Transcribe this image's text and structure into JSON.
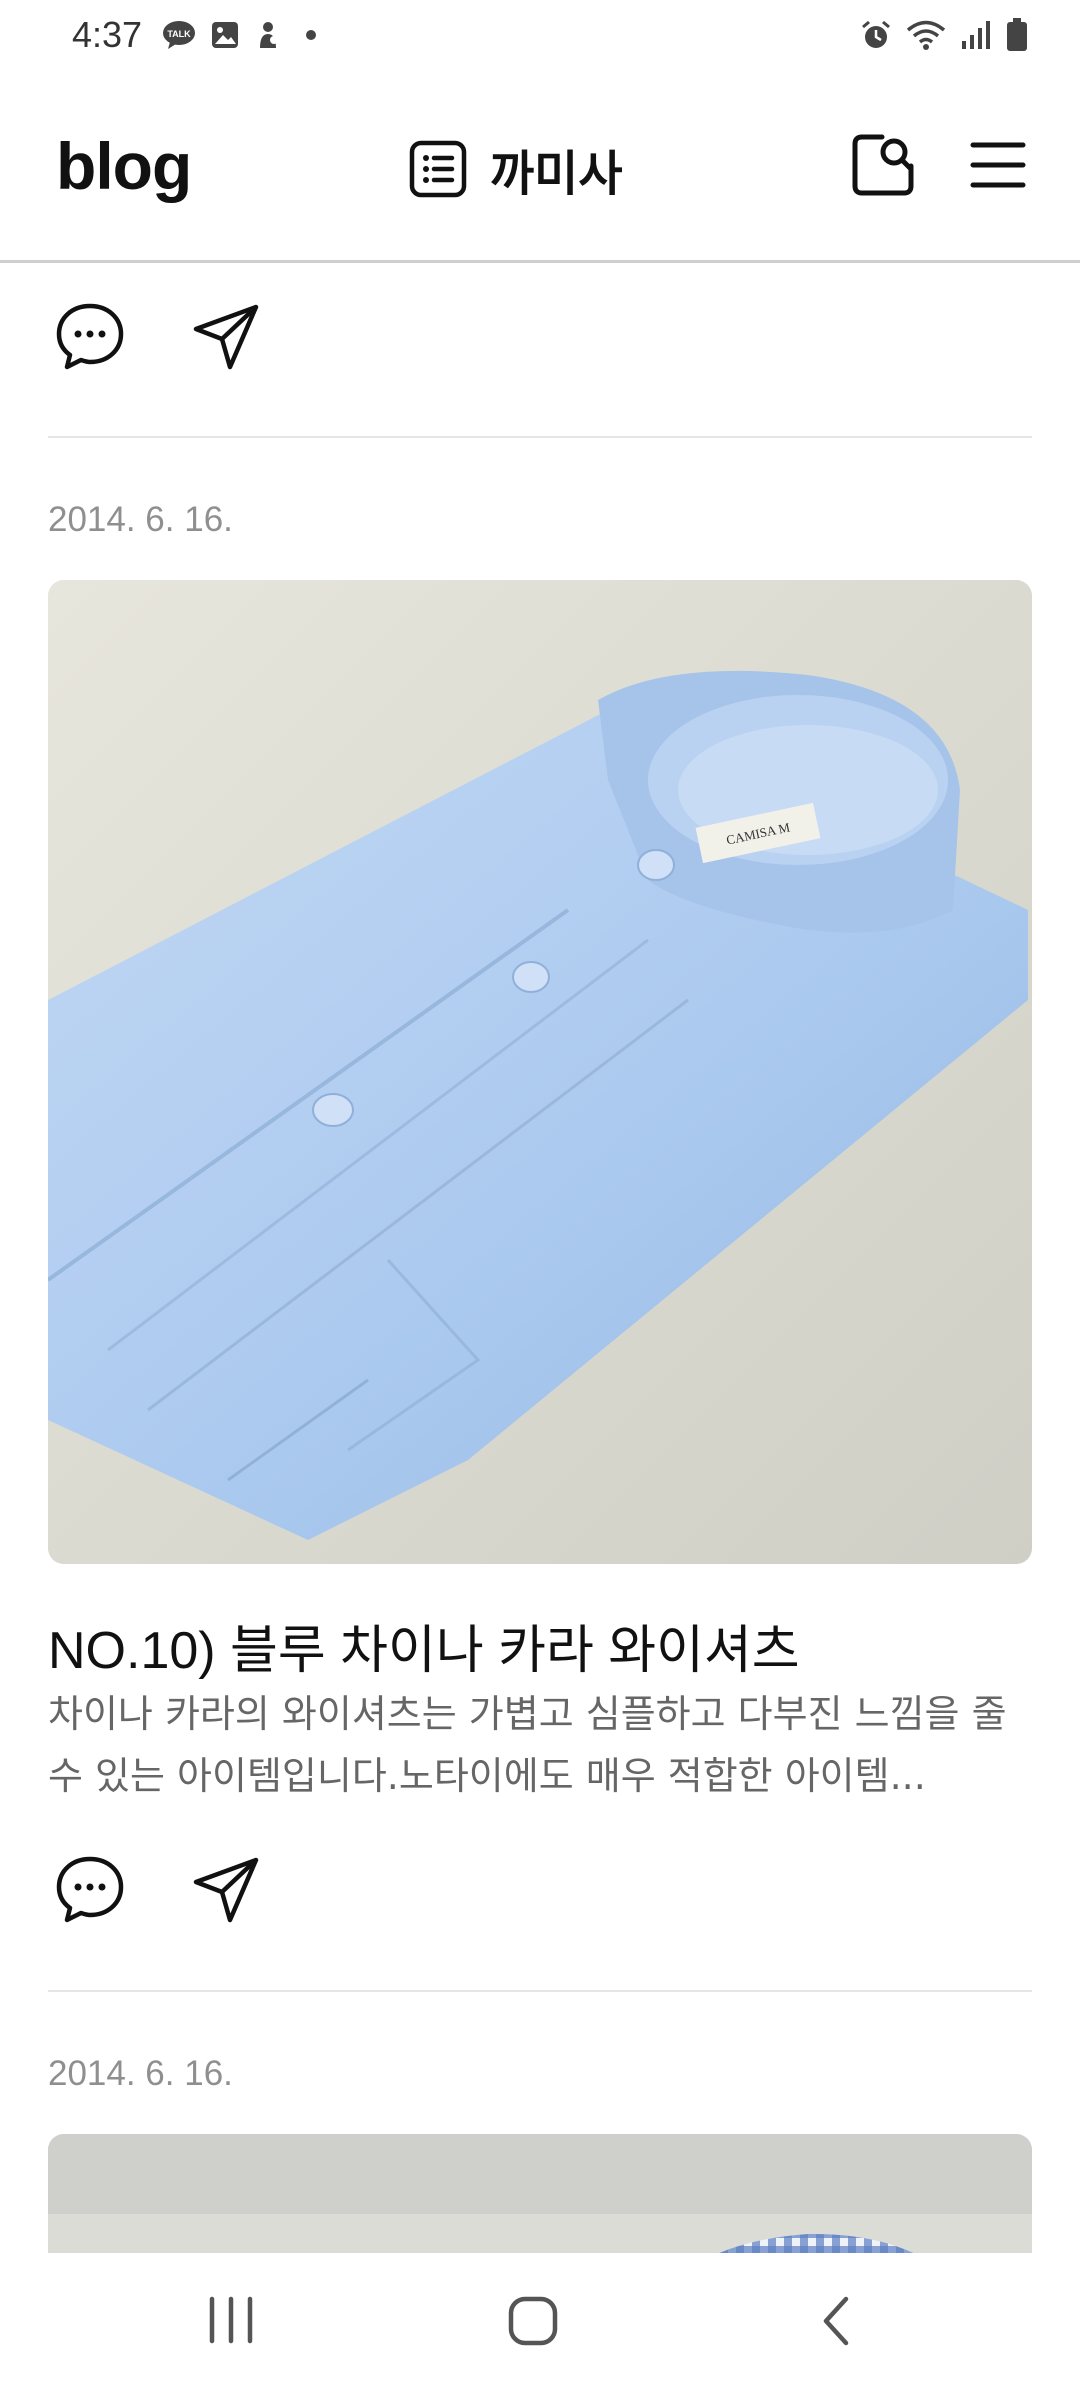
{
  "status_bar": {
    "time": "4:37",
    "left_icons": [
      "kakaotalk-icon",
      "gallery-icon",
      "app-icon",
      "dot-icon"
    ],
    "right_icons": [
      "alarm-icon",
      "wifi-icon",
      "signal-icon",
      "battery-icon"
    ]
  },
  "header": {
    "logo": "blog",
    "blog_title": "까미사",
    "icons": [
      "list-icon",
      "search-icon",
      "menu-icon"
    ]
  },
  "posts": [
    {
      "date": "2014. 6. 16.",
      "title": "NO.10) 블루 차이나 카라 와이셔츠",
      "excerpt": "차이나 카라의 와이셔츠는 가볍고 심플하고 다부진 느낌을 줄수 있는 아이템입니다.노타이에도 매우 적합한 아이템...",
      "image_label": "CAMISA M"
    },
    {
      "date": "2014. 6. 16."
    }
  ],
  "colors": {
    "accent_text": "#111111",
    "muted_text": "#8f8f8f",
    "divider": "#e6e6e6",
    "shirt_blue": "#a9c8ee"
  }
}
